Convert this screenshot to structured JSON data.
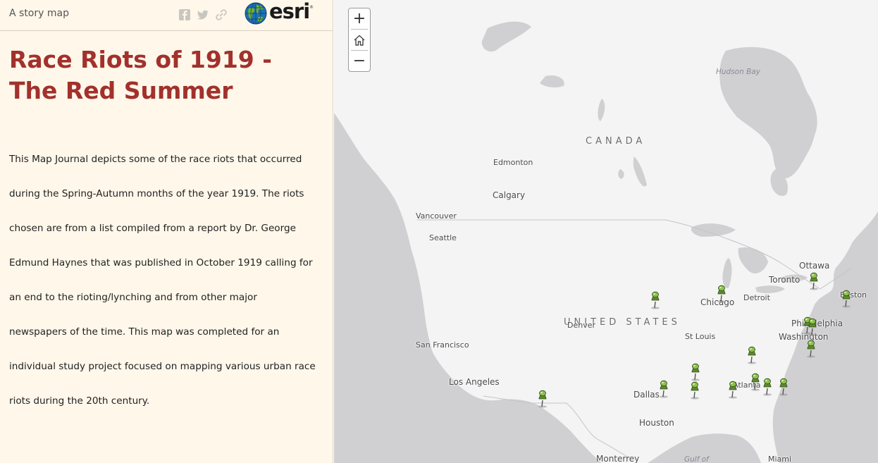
{
  "header": {
    "tagline": "A story map",
    "share": {
      "facebook_icon": "facebook-icon",
      "twitter_icon": "twitter-icon",
      "link_icon": "link-icon"
    },
    "logo_text": "esri",
    "logo_mark": "®"
  },
  "panel": {
    "title": "Race Riots of 1919 - The Red Summer",
    "description": "This Map Journal depicts some of the race riots that occurred during the Spring-Autumn months of the year 1919. The riots chosen are from a list compiled from a report by Dr. George Edmund Haynes that was published in October 1919 calling for an end to the rioting/lynching and from other major newspapers of the time. This map was completed for an individual study project focused on mapping various urban race riots during the 20th century."
  },
  "map": {
    "controls": {
      "zoom_in": "+",
      "home_icon": "home-icon",
      "zoom_out": "−"
    },
    "labels": {
      "hudson_bay": "Hudson Bay",
      "canada": "CANADA",
      "edmonton": "Edmonton",
      "calgary": "Calgary",
      "vancouver": "Vancouver",
      "seattle": "Seattle",
      "ottawa": "Ottawa",
      "toronto": "Toronto",
      "boston": "Boston",
      "chicago": "Chicago",
      "detroit": "Detroit",
      "united_states": "UNITED STATES",
      "denver": "Denver",
      "philadelphia": "Philadelphia",
      "washington": "Washington",
      "san_francisco": "San Francisco",
      "st_louis": "St Louis",
      "los_angeles": "Los Angeles",
      "dallas": "Dallas",
      "atlanta": "Atlanta",
      "houston": "Houston",
      "monterrey": "Monterrey",
      "gulf": "Gulf of",
      "miami": "Miami"
    },
    "marker_icon": "pushpin-icon",
    "marker_color": "#5d8a2e",
    "colors": {
      "land": "#f4f4f4",
      "water": "#d0d0d2",
      "title": "#a2312c",
      "panel_bg": "#fef7ea"
    }
  }
}
